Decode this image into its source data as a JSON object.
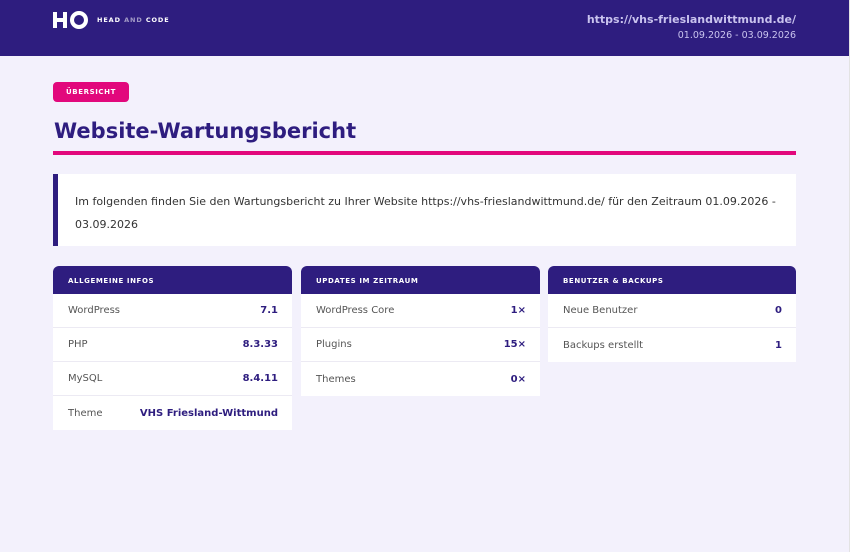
{
  "colors": {
    "primary": "#2e1d7f",
    "accent": "#e2087c",
    "background": "#f3f1fc"
  },
  "header": {
    "logo_icon": "head-and-code-logo",
    "brand_part1": "HEAD",
    "brand_part2": "AND",
    "brand_part3": "CODE",
    "site_url": "https://vhs-frieslandwittmund.de/",
    "period": "01.09.2026 - 03.09.2026"
  },
  "badge": "ÜBERSICHT",
  "title": "Website-Wartungsbericht",
  "intro": "Im folgenden finden Sie den Wartungsbericht zu Ihrer Website https://vhs-frieslandwittmund.de/ für den Zeitraum 01.09.2026 - 03.09.2026",
  "cards": [
    {
      "title": "ALLGEMEINE INFOS",
      "rows": [
        {
          "label": "WordPress",
          "value": "7.1"
        },
        {
          "label": "PHP",
          "value": "8.3.33"
        },
        {
          "label": "MySQL",
          "value": "8.4.11"
        },
        {
          "label": "Theme",
          "value": "VHS Friesland-Wittmund"
        }
      ]
    },
    {
      "title": "UPDATES IM ZEITRAUM",
      "rows": [
        {
          "label": "WordPress Core",
          "value": "1×"
        },
        {
          "label": "Plugins",
          "value": "15×"
        },
        {
          "label": "Themes",
          "value": "0×"
        }
      ]
    },
    {
      "title": "BENUTZER & BACKUPS",
      "rows": [
        {
          "label": "Neue Benutzer",
          "value": "0"
        },
        {
          "label": "Backups erstellt",
          "value": "1"
        }
      ]
    }
  ]
}
